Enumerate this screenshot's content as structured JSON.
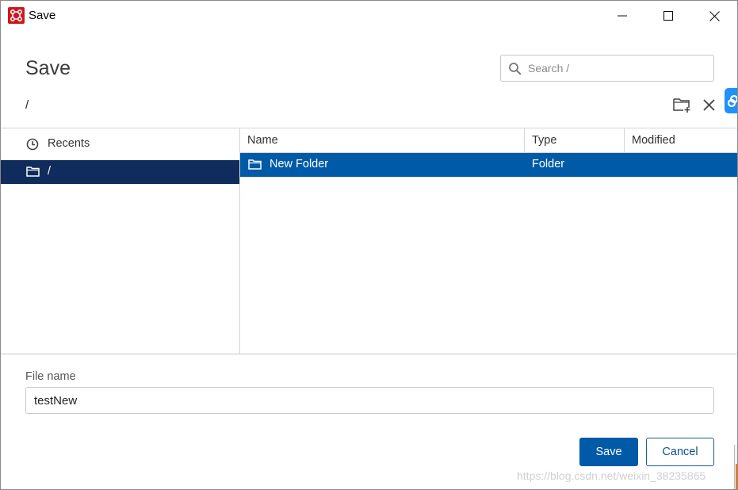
{
  "window": {
    "title": "Save",
    "icons": {
      "app": "app-logo-icon",
      "minimize": "minimize-icon",
      "maximize": "maximize-icon",
      "close": "close-icon"
    }
  },
  "header": {
    "heading": "Save",
    "search": {
      "placeholder": "Search /",
      "value": "",
      "icon": "search-icon"
    },
    "current_path": "/",
    "tools": {
      "new_folder_icon": "new-folder-icon",
      "delete_icon": "close-icon"
    }
  },
  "sidebar": {
    "items": [
      {
        "label": "Recents",
        "icon": "clock-icon",
        "selected": false
      },
      {
        "label": "/",
        "icon": "folder-icon",
        "selected": true
      }
    ]
  },
  "file_list": {
    "columns": [
      "Name",
      "Type",
      "Modified"
    ],
    "rows": [
      {
        "name": "New Folder",
        "type": "Folder",
        "modified": "",
        "icon": "folder-icon",
        "selected": true
      }
    ]
  },
  "footer": {
    "filename_label": "File name",
    "filename_value": "testNew",
    "save_label": "Save",
    "cancel_label": "Cancel"
  },
  "watermark": "https://blog.csdn.net/weixin_38235865",
  "colors": {
    "accent": "#005aa7",
    "sidebar_selected": "#0f2c5c",
    "app_icon": "#d2161c",
    "side_tab": "#1e90ff"
  }
}
